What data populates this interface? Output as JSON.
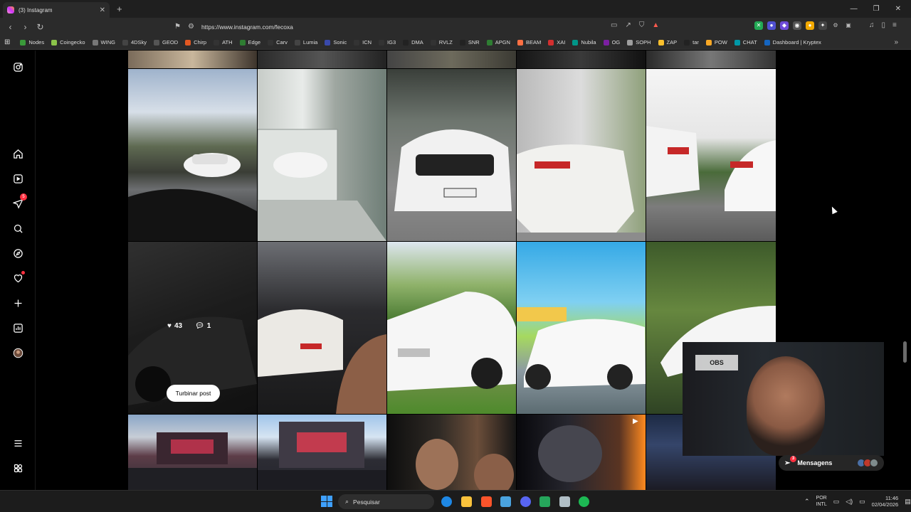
{
  "browser": {
    "tab_title": "(3) Instagram",
    "url": "https://www.instagram.com/fecoxa",
    "bookmarks": [
      "Nodes",
      "Coingecko",
      "WING",
      "4DSky",
      "GEOD",
      "Chirp",
      "ATH",
      "Edge",
      "Carv",
      "Lumia",
      "Sonic",
      "ICN",
      "IG3",
      "DMA",
      "RVLZ",
      "SNR",
      "APGN",
      "BEAM",
      "XAI",
      "Nubila",
      "OG",
      "SOPH",
      "ZAP",
      "tar",
      "POW",
      "CHAT",
      "Dashboard | Kryptex"
    ],
    "bookmark_colors": [
      "#3a9a3a",
      "#8bc34a",
      "#777777",
      "#444444",
      "#555555",
      "#e25822",
      "#333333",
      "#2e7d32",
      "#333333",
      "#444444",
      "#3949ab",
      "#333333",
      "#333333",
      "#222222",
      "#333333",
      "#222222",
      "#2e7d32",
      "#ff7043",
      "#d32f2f",
      "#009688",
      "#7b1fa2",
      "#9e9e9e",
      "#fbc02d",
      "#222222",
      "#f9a825",
      "#0097a7",
      "#1565c0"
    ]
  },
  "sidenav": {
    "items": [
      {
        "name": "instagram-logo-icon"
      },
      {
        "name": "home-icon"
      },
      {
        "name": "reels-icon"
      },
      {
        "name": "messages-icon",
        "badge": "5"
      },
      {
        "name": "search-icon"
      },
      {
        "name": "explore-icon"
      },
      {
        "name": "notifications-icon"
      },
      {
        "name": "create-icon"
      },
      {
        "name": "dashboard-icon"
      },
      {
        "name": "profile-avatar"
      },
      {
        "name": "more-menu-icon"
      },
      {
        "name": "also-from-meta-icon"
      }
    ]
  },
  "grid": {
    "hover_post": {
      "likes": "43",
      "comments": "1",
      "boost_label": "Turbinar post"
    }
  },
  "webcam": {
    "sign_text": "OBS"
  },
  "messages": {
    "label": "Mensagens",
    "badge": "3"
  },
  "taskbar": {
    "search_placeholder": "Pesquisar",
    "lang_1": "POR",
    "lang_2": "INTL",
    "time": "11:46",
    "date": "02/04/2026"
  }
}
